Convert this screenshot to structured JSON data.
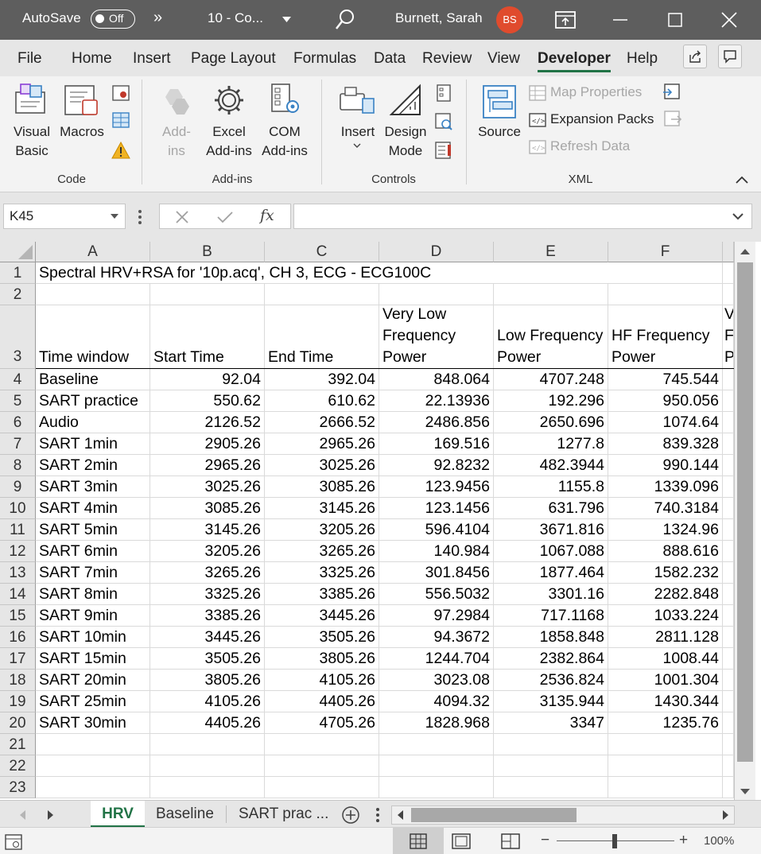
{
  "titlebar": {
    "autosave_label": "AutoSave",
    "autosave_state": "Off",
    "more_glyph": "»",
    "doc_title": "10 - Co...",
    "user_name": "Burnett, Sarah",
    "user_initials": "BS",
    "avatar_color": "#e04b2d"
  },
  "menu": {
    "items": [
      "File",
      "Home",
      "Insert",
      "Page Layout",
      "Formulas",
      "Data",
      "Review",
      "View",
      "Developer",
      "Help"
    ],
    "active": "Developer",
    "accent": "#217346"
  },
  "ribbon": {
    "code": {
      "visual_basic": [
        "Visual",
        "Basic"
      ],
      "macros": "Macros",
      "label": "Code"
    },
    "addins": {
      "add_ins": [
        "Add-",
        "ins"
      ],
      "excel_addins": [
        "Excel",
        "Add-ins"
      ],
      "com_addins": [
        "COM",
        "Add-ins"
      ],
      "label": "Add-ins"
    },
    "controls": {
      "insert": "Insert",
      "design_mode": [
        "Design",
        "Mode"
      ],
      "label": "Controls"
    },
    "xml": {
      "source": "Source",
      "map_properties": "Map Properties",
      "expansion_packs": "Expansion Packs",
      "refresh_data": "Refresh Data",
      "label": "XML"
    }
  },
  "formula_bar": {
    "name_box": "K45",
    "fx": "fx",
    "formula": ""
  },
  "sheet": {
    "columns": [
      "A",
      "B",
      "C",
      "D",
      "E",
      "F"
    ],
    "row_numbers": [
      "1",
      "2",
      "3",
      "4",
      "5",
      "6",
      "7",
      "8",
      "9",
      "10",
      "11",
      "12",
      "13",
      "14",
      "15",
      "16",
      "17",
      "18",
      "19",
      "20",
      "21",
      "22",
      "23"
    ],
    "title": "Spectral HRV+RSA for '10p.acq', CH 3, ECG - ECG100C",
    "headers": [
      "Time window",
      "Start Time",
      "End Time",
      "Very Low Frequency Power",
      "Low Frequency Power",
      "HF Frequency Power"
    ],
    "g_header_fragment": [
      "V",
      "F",
      "P"
    ],
    "rows": [
      [
        "Baseline",
        "92.04",
        "392.04",
        "848.064",
        "4707.248",
        "745.544"
      ],
      [
        "SART practice",
        "550.62",
        "610.62",
        "22.13936",
        "192.296",
        "950.056"
      ],
      [
        "Audio",
        "2126.52",
        "2666.52",
        "2486.856",
        "2650.696",
        "1074.64"
      ],
      [
        "SART 1min",
        "2905.26",
        "2965.26",
        "169.516",
        "1277.8",
        "839.328"
      ],
      [
        "SART 2min",
        "2965.26",
        "3025.26",
        "92.8232",
        "482.3944",
        "990.144"
      ],
      [
        "SART 3min",
        "3025.26",
        "3085.26",
        "123.9456",
        "1155.8",
        "1339.096"
      ],
      [
        "SART 4min",
        "3085.26",
        "3145.26",
        "123.1456",
        "631.796",
        "740.3184"
      ],
      [
        "SART 5min",
        "3145.26",
        "3205.26",
        "596.4104",
        "3671.816",
        "1324.96"
      ],
      [
        "SART 6min",
        "3205.26",
        "3265.26",
        "140.984",
        "1067.088",
        "888.616"
      ],
      [
        "SART 7min",
        "3265.26",
        "3325.26",
        "301.8456",
        "1877.464",
        "1582.232"
      ],
      [
        "SART 8min",
        "3325.26",
        "3385.26",
        "556.5032",
        "3301.16",
        "2282.848"
      ],
      [
        "SART 9min",
        "3385.26",
        "3445.26",
        "97.2984",
        "717.1168",
        "1033.224"
      ],
      [
        "SART 10min",
        "3445.26",
        "3505.26",
        "94.3672",
        "1858.848",
        "2811.128"
      ],
      [
        "SART 15min",
        "3505.26",
        "3805.26",
        "1244.704",
        "2382.864",
        "1008.44"
      ],
      [
        "SART 20min",
        "3805.26",
        "4105.26",
        "3023.08",
        "2536.824",
        "1001.304"
      ],
      [
        "SART 25min",
        "4105.26",
        "4405.26",
        "4094.32",
        "3135.944",
        "1430.344"
      ],
      [
        "SART 30min",
        "4405.26",
        "4705.26",
        "1828.968",
        "3347",
        "1235.76"
      ]
    ]
  },
  "tabs": {
    "items": [
      "HRV",
      "Baseline",
      "SART prac ..."
    ],
    "active": "HRV"
  },
  "status": {
    "zoom": "100%",
    "minus": "−",
    "plus": "+"
  }
}
